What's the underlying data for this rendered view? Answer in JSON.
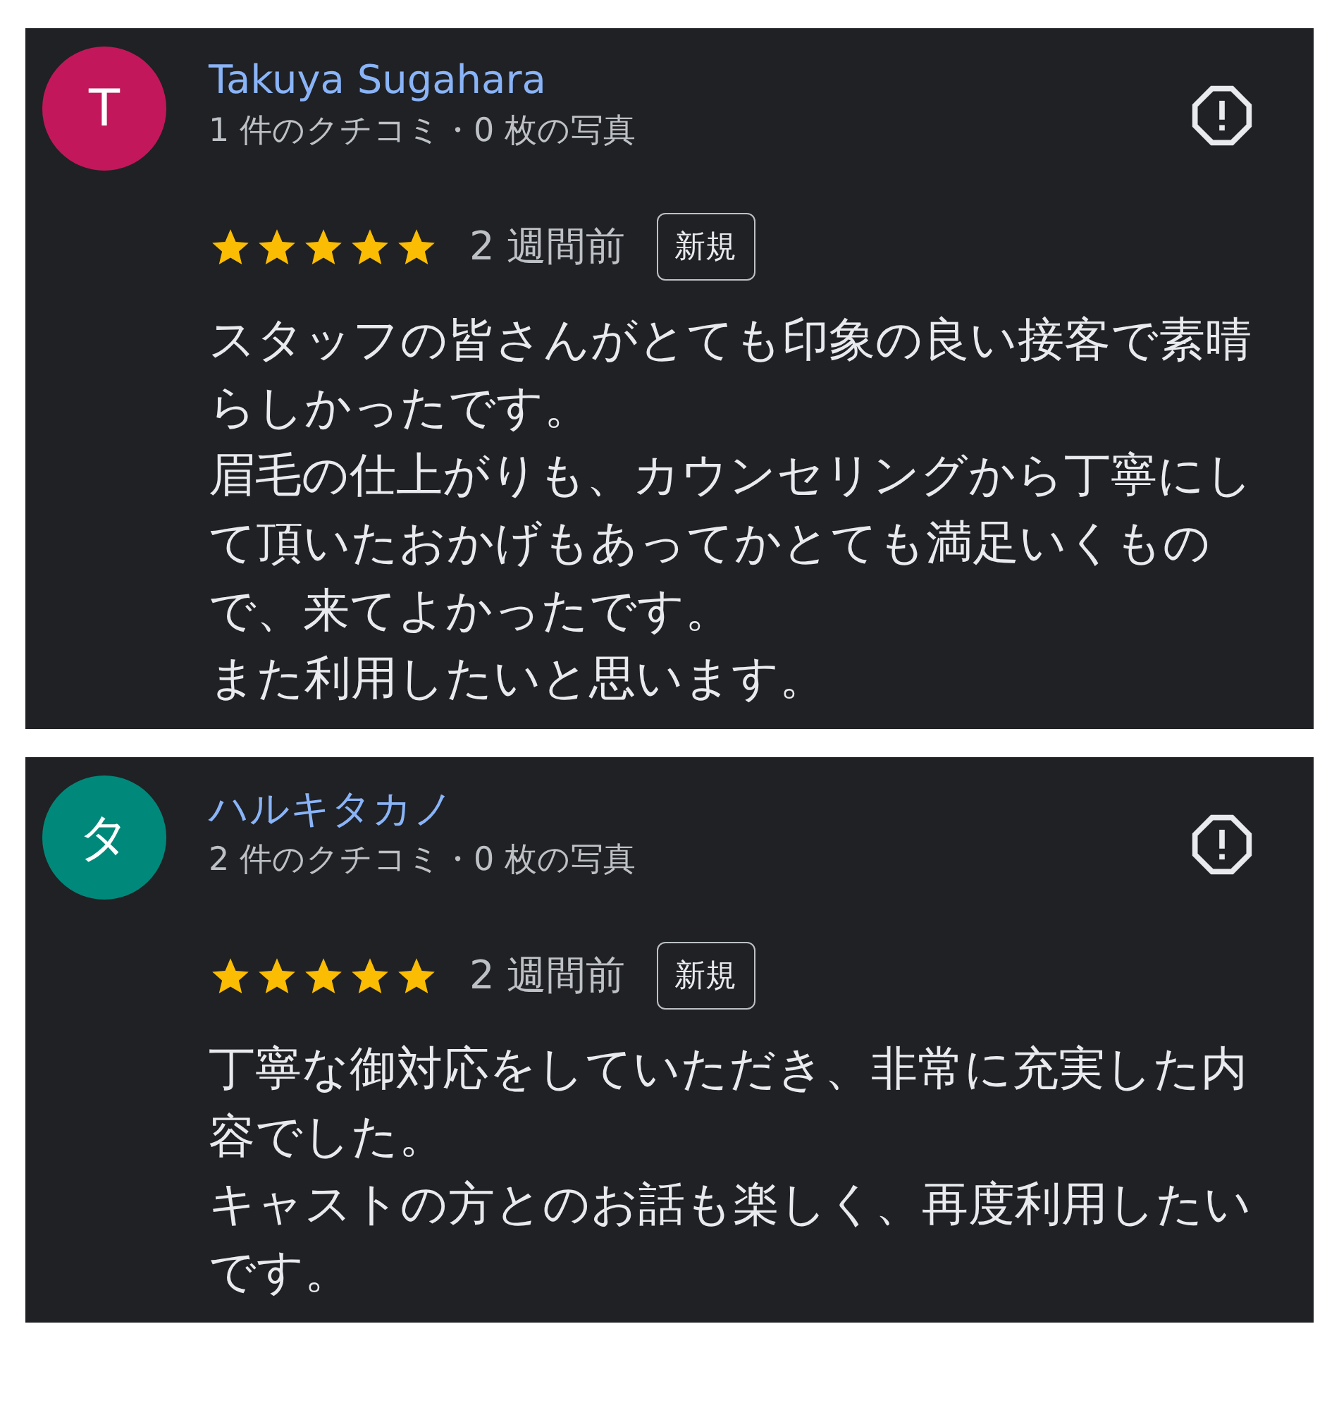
{
  "reviews": [
    {
      "avatar_letter": "T",
      "color": "#c2185b",
      "name": "Takuya Sugahara",
      "meta": "1 件のクチコミ・0 枚の写真",
      "stars": 5,
      "time": "2 週間前",
      "badge": "新規",
      "body": [
        "スタッフの皆さんがとても印象の良い接客で素晴らしかったです。",
        "眉毛の仕上がりも、カウンセリングから丁寧にして頂いたおかげもあってかとても満足いくもので、来てよかったです。",
        "また利用したいと思います。"
      ]
    },
    {
      "avatar_letter": "タ",
      "color": "#00897b",
      "name": "ハルキタカノ",
      "meta": "2 件のクチコミ・0 枚の写真",
      "stars": 5,
      "time": "2 週間前",
      "badge": "新規",
      "body": [
        "丁寧な御対応をしていただき、非常に充実した内容でした。",
        "キャストの方とのお話も楽しく、再度利用したいです。"
      ]
    }
  ]
}
